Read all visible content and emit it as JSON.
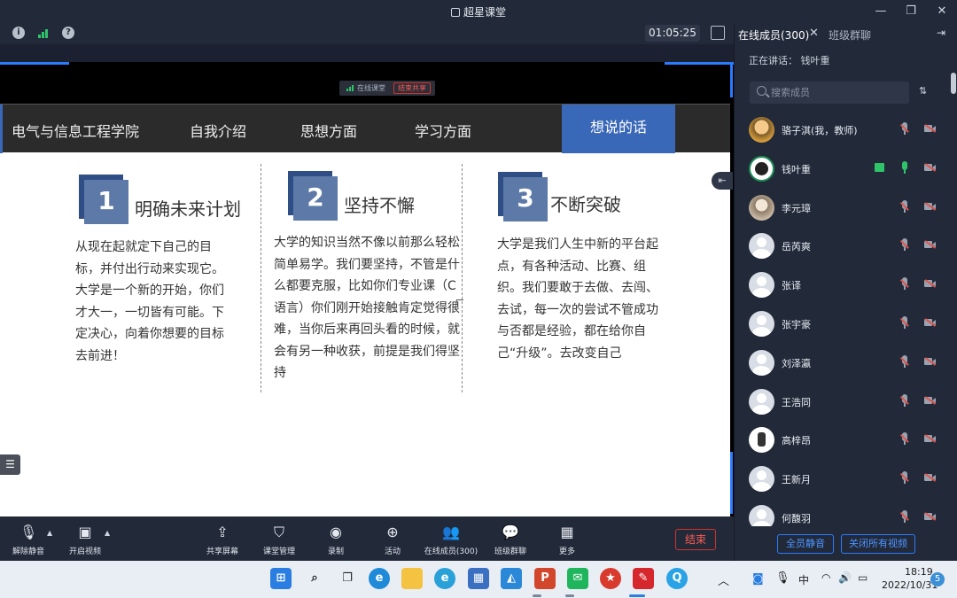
{
  "app": {
    "title": "超星课堂",
    "window_controls": [
      "minimize-icon",
      "restore-icon",
      "close-icon"
    ]
  },
  "topbar": {
    "timer": "01:05:25",
    "icons": [
      "info-icon",
      "signal-icon",
      "help-icon",
      "fullscreen-icon"
    ]
  },
  "share_indicator": {
    "label": "在线课堂",
    "stop_label": "结束共享"
  },
  "slide": {
    "nav": [
      "电气与信息工程学院",
      "自我介绍",
      "思想方面",
      "学习方面"
    ],
    "active_tab": "想说的话",
    "columns": [
      {
        "number": "1",
        "title": "明确未来计划",
        "body": "从现在起就定下自己的目标，并付出行动来实现它。大学是一个新的开始，你们才大一，一切皆有可能。下定决心，向着你想要的目标去前进！"
      },
      {
        "number": "2",
        "title": "坚持不懈",
        "body": "大学的知识当然不像以前那么轻松简单易学。我们要坚持，不管是什么都要克服，比如你们专业课（C语言）你们刚开始接触肯定觉得很难，当你后来再回头看的时候，就会有另一种收获，前提是我们得坚持"
      },
      {
        "number": "3",
        "title": "不断突破",
        "body": "大学是我们人生中新的平台起点，有各种活动、比赛、组织。我们要敢于去做、去闯、去试，每一次的尝试不管成功与否都是经验，都在给你自己“升级”。去改变自己"
      }
    ]
  },
  "toolbar": {
    "unmute": "解除静音",
    "start_video": "开启视频",
    "share_screen": "共享屏幕",
    "class_manage": "课堂管理",
    "record": "录制",
    "activity": "活动",
    "online_members": "在线成员(300)",
    "class_chat": "班级群聊",
    "more": "更多",
    "end": "结束"
  },
  "panel": {
    "tab_members": "在线成员(300)",
    "tab_chat": "班级群聊",
    "speaking": "正在讲话：  钱叶重",
    "search_placeholder": "搜索成员",
    "members": [
      {
        "name": "骆子淇(我，教师)",
        "avatar": "photo1",
        "mic": "off",
        "cam": "off"
      },
      {
        "name": "钱叶重",
        "avatar": "photo2",
        "mic": "on",
        "cam": "off",
        "sharing": true
      },
      {
        "name": "李元璋",
        "avatar": "photo3",
        "mic": "off",
        "cam": "off"
      },
      {
        "name": "岳芮爽",
        "avatar": "default",
        "mic": "off",
        "cam": "off"
      },
      {
        "name": "张译",
        "avatar": "default",
        "mic": "off",
        "cam": "off"
      },
      {
        "name": "张宇豪",
        "avatar": "default",
        "mic": "off",
        "cam": "off"
      },
      {
        "name": "刘泽瀛",
        "avatar": "default",
        "mic": "off",
        "cam": "off"
      },
      {
        "name": "王浩同",
        "avatar": "default",
        "mic": "off",
        "cam": "off"
      },
      {
        "name": "高梓昂",
        "avatar": "photo4",
        "mic": "off",
        "cam": "off"
      },
      {
        "name": "王新月",
        "avatar": "default",
        "mic": "off",
        "cam": "off"
      },
      {
        "name": "何馥羽",
        "avatar": "default",
        "mic": "off",
        "cam": "off"
      }
    ],
    "mute_all": "全员静音",
    "close_all_video": "关闭所有视频"
  },
  "taskbar": {
    "apps": [
      "windows-start-icon",
      "search-icon",
      "task-view-icon",
      "edge-icon",
      "file-explorer-icon",
      "edge-dev-icon",
      "store-icon",
      "photos-icon",
      "powerpoint-icon",
      "wechat-icon",
      "party-app-icon",
      "chaoxing-icon",
      "qq-browser-icon"
    ],
    "tray_ime": "中",
    "time": "18:19",
    "date": "2022/10/31",
    "notifications": "5",
    "colors": {
      "accent": "#2b7bff",
      "end_red": "#d0332c",
      "slide_blue": "#3a68b8"
    }
  }
}
